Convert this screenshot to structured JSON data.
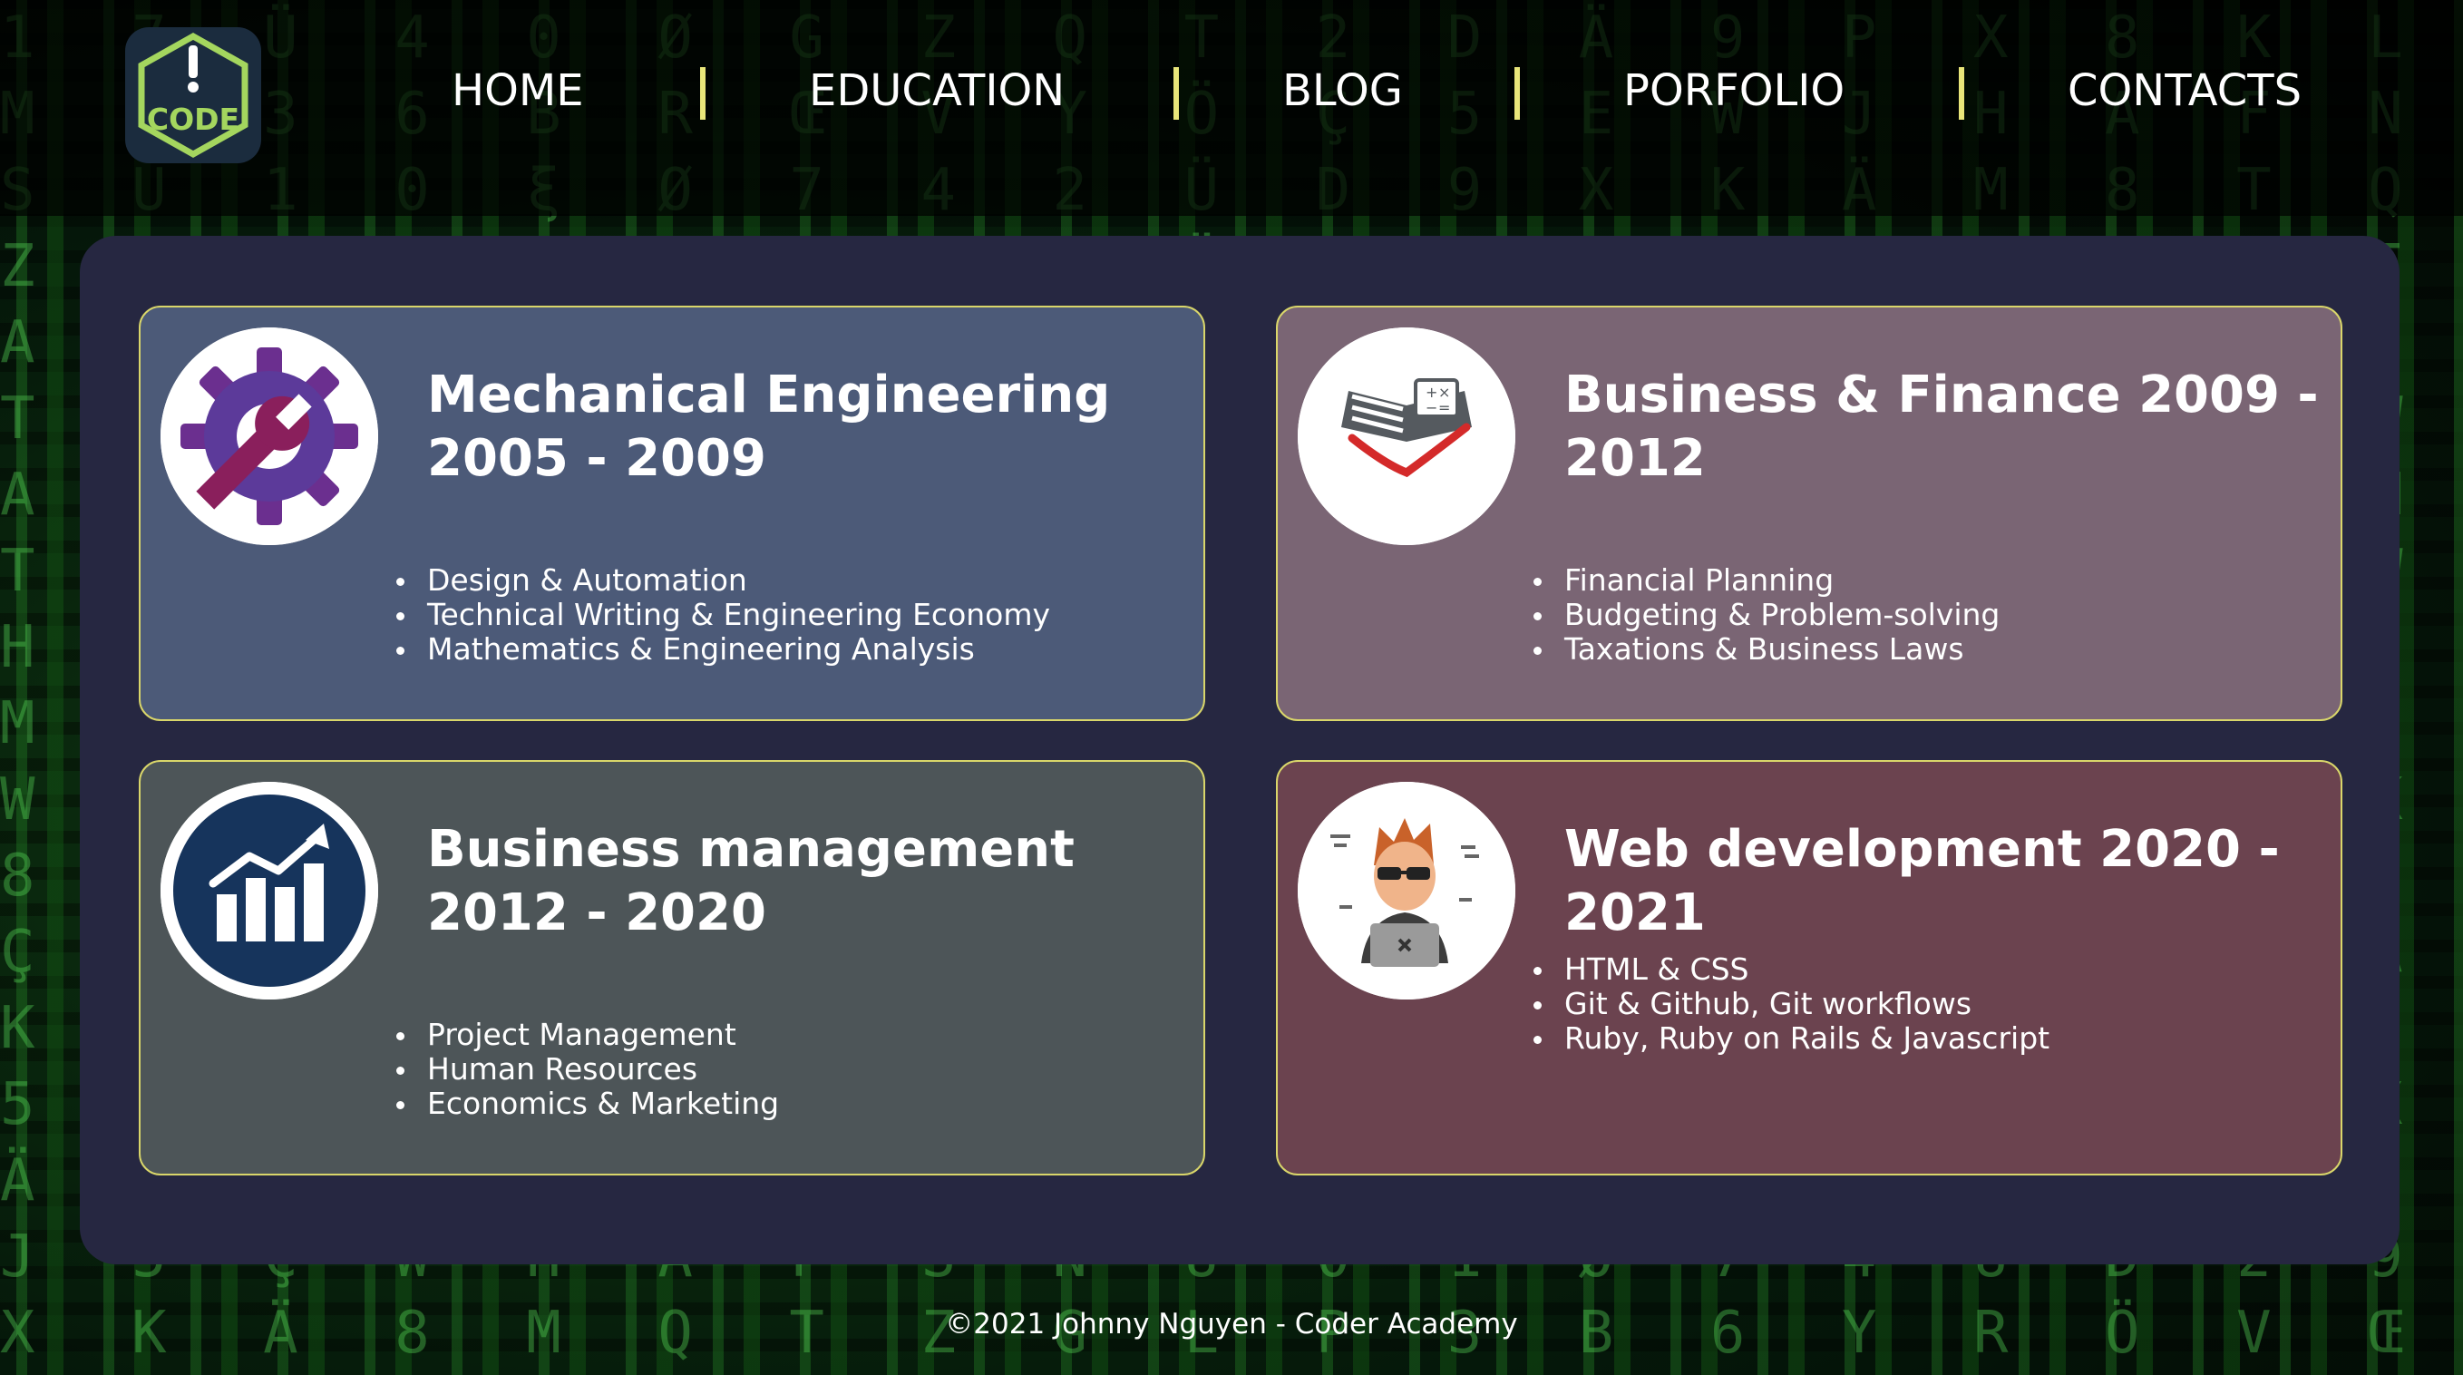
{
  "nav": {
    "logo_text": "CODE",
    "items": [
      {
        "label": "HOME"
      },
      {
        "label": "EDUCATION"
      },
      {
        "label": "BLOG"
      },
      {
        "label": "PORFOLIO"
      },
      {
        "label": "CONTACTS"
      }
    ]
  },
  "education": {
    "cards": [
      {
        "title": "Mechanical Engineering 2005 - 2009",
        "icon": "gear-wrench-icon",
        "bg_color": "#4c5a78",
        "items": [
          "Design & Automation",
          "Technical Writing & Engineering Economy",
          "Mathematics & Engineering Analysis"
        ]
      },
      {
        "title": "Business & Finance 2009 - 2012",
        "icon": "finance-book-icon",
        "bg_color": "#7a6574",
        "items": [
          "Financial Planning",
          "Budgeting & Problem-solving",
          "Taxations & Business Laws"
        ]
      },
      {
        "title": "Business management 2012 - 2020",
        "icon": "growth-chart-icon",
        "bg_color": "#4d5558",
        "items": [
          "Project Management",
          "Human Resources",
          "Economics & Marketing"
        ]
      },
      {
        "title": "Web development 2020 - 2021",
        "icon": "developer-avatar-icon",
        "bg_color": "#6b434f",
        "items": [
          "HTML & CSS",
          "Git & Github, Git workflows",
          "Ruby, Ruby on Rails & Javascript"
        ]
      }
    ]
  },
  "footer": {
    "text": "©2021 Johnny Nguyen - Coder Academy"
  },
  "colors": {
    "panel": "#262741",
    "card_border": "#d9d66a",
    "nav_separator": "#e9e67a",
    "logo_accent": "#a4d65e"
  }
}
